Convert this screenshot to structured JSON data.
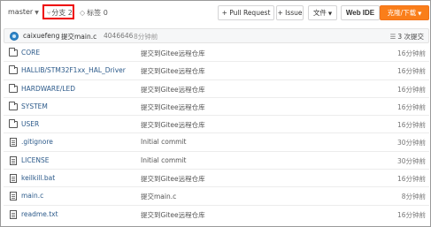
{
  "toolbar": {
    "branch": "master",
    "branches_label": "分支",
    "branches_count": "2",
    "tags_label": "标签",
    "tags_count": "0",
    "pull_request": "+ Pull Request",
    "issue": "+ Issue",
    "file_menu": "文件",
    "web_ide": "Web IDE",
    "clone_download": "克隆/下载",
    "accent_color": "#fa7e1a",
    "highlight_color": "#e00000"
  },
  "commit": {
    "author": "caixuefeng",
    "message": "提交main.c",
    "hash": "4046646",
    "time": "8分钟前",
    "count_label": "3 次提交"
  },
  "files": [
    {
      "type": "folder",
      "name": "CORE",
      "message": "提交到Gitee远程仓库",
      "time": "16分钟前"
    },
    {
      "type": "folder",
      "name": "HALLIB/STM32F1xx_HAL_Driver",
      "message": "提交到Gitee远程仓库",
      "time": "16分钟前"
    },
    {
      "type": "folder",
      "name": "HARDWARE/LED",
      "message": "提交到Gitee远程仓库",
      "time": "16分钟前"
    },
    {
      "type": "folder",
      "name": "SYSTEM",
      "message": "提交到Gitee远程仓库",
      "time": "16分钟前"
    },
    {
      "type": "folder",
      "name": "USER",
      "message": "提交到Gitee远程仓库",
      "time": "16分钟前"
    },
    {
      "type": "file",
      "name": ".gitignore",
      "message": "Initial commit",
      "time": "30分钟前"
    },
    {
      "type": "file",
      "name": "LICENSE",
      "message": "Initial commit",
      "time": "30分钟前"
    },
    {
      "type": "file",
      "name": "keilkill.bat",
      "message": "提交到Gitee远程仓库",
      "time": "16分钟前"
    },
    {
      "type": "file",
      "name": "main.c",
      "message": "提交main.c",
      "time": "8分钟前"
    },
    {
      "type": "file",
      "name": "readme.txt",
      "message": "提交到Gitee远程仓库",
      "time": "16分钟前"
    }
  ]
}
